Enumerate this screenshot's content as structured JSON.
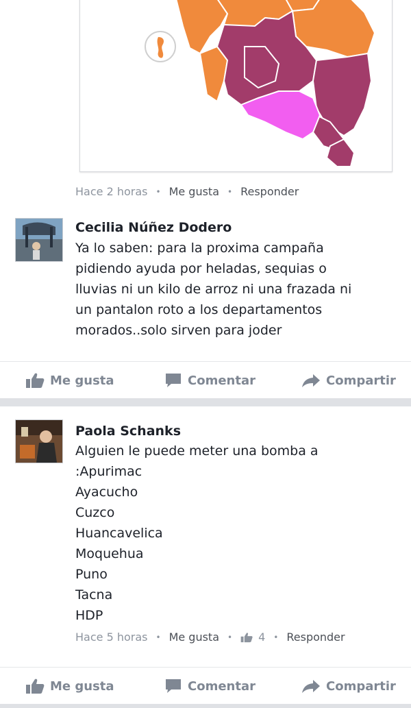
{
  "comment1": {
    "time": "Hace 2 horas",
    "like": "Me gusta",
    "reply": "Responder"
  },
  "comment2": {
    "author": "Cecilia Núñez Dodero",
    "text": "Ya lo saben: para la proxima campaña\npidiendo ayuda por heladas, sequias o\nlluvias ni un kilo de arroz ni una frazada ni\nun pantalon roto a los departamentos\nmorados..solo sirven para joder"
  },
  "post_actions_1": {
    "like": "Me gusta",
    "comment": "Comentar",
    "share": "Compartir"
  },
  "comment3": {
    "author": "Paola Schanks",
    "text": "Alguien le puede meter una bomba a\n:Apurimac\nAyacucho\nCuzco\nHuancavelica\nMoquehua\nPuno\nTacna\nHDP",
    "time": "Hace 5 horas",
    "like": "Me gusta",
    "like_count": "4",
    "reply": "Responder"
  },
  "post_actions_2": {
    "like": "Me gusta",
    "comment": "Comentar",
    "share": "Compartir"
  },
  "colors": {
    "orange_region": "#f08a3c",
    "purple_region": "#a23c6a",
    "magenta_region": "#f25ef0",
    "meta_gray": "#8d949e",
    "action_gray": "#7f8793"
  },
  "icons": [
    "thumbs-up-icon",
    "comment-bubble-icon",
    "share-arrow-icon"
  ]
}
